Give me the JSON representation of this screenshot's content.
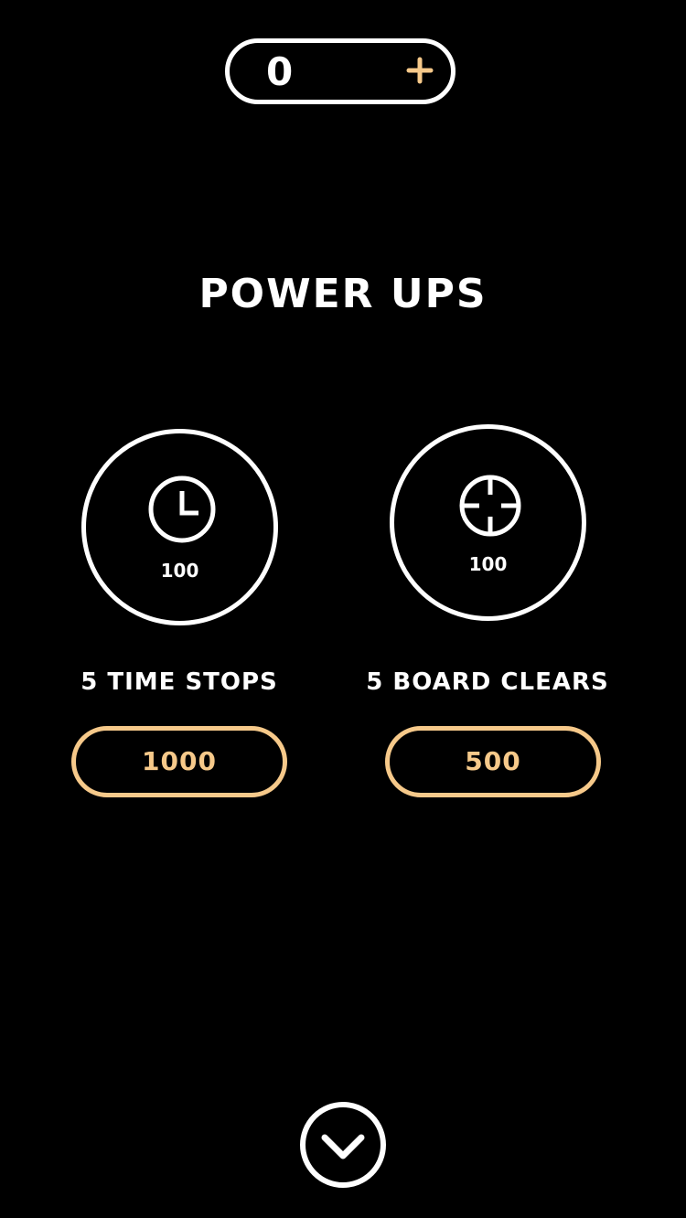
{
  "header": {
    "coin_count": "0",
    "add_icon": "plus-icon"
  },
  "title": "POWER UPS",
  "powerups": [
    {
      "icon": "clock-icon",
      "count": "100",
      "label": "5 TIME STOPS",
      "price": "1000"
    },
    {
      "icon": "crosshair-icon",
      "count": "100",
      "label": "5 BOARD CLEARS",
      "price": "500"
    }
  ],
  "footer": {
    "close_icon": "chevron-down-icon"
  },
  "colors": {
    "background": "#000000",
    "foreground": "#ffffff",
    "accent": "#f6c98a"
  }
}
